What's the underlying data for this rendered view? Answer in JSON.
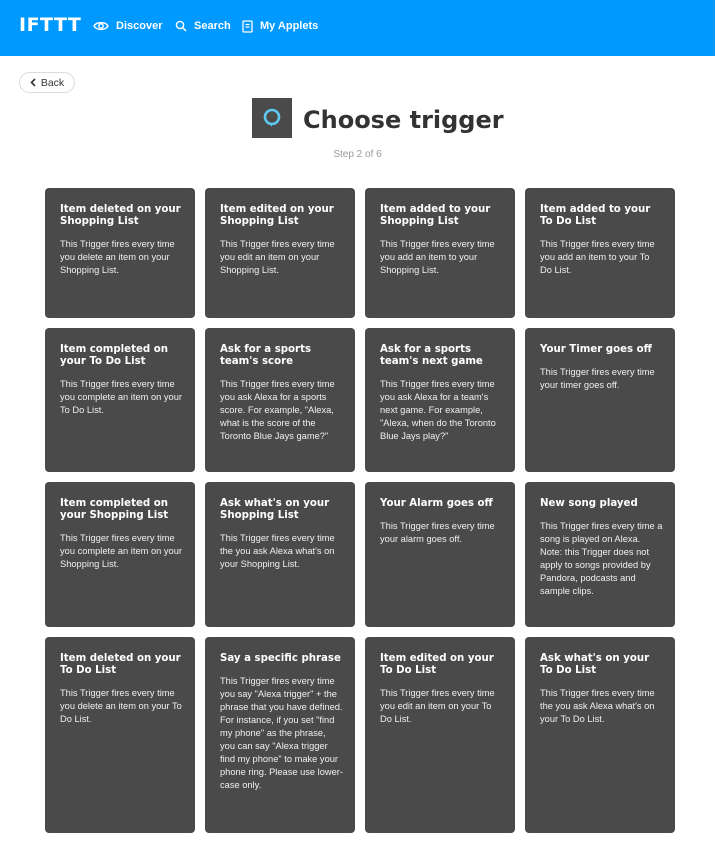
{
  "header": {
    "logo": "IFTTT",
    "nav": [
      {
        "label": "Discover",
        "icon": "eye-icon"
      },
      {
        "label": "Search",
        "icon": "search-icon"
      },
      {
        "label": "My Applets",
        "icon": "applets-icon"
      }
    ]
  },
  "back_label": "Back",
  "page": {
    "title": "Choose trigger",
    "step": "Step 2 of 6",
    "service_icon": "alexa-icon"
  },
  "colors": {
    "header_bg": "#0099ff",
    "card_bg": "#4a4a4a",
    "title_text": "#333333"
  },
  "triggers": [
    {
      "title": "Item deleted on your Shopping List",
      "desc": "This Trigger fires every time you delete an item on your Shopping List."
    },
    {
      "title": "Item edited on your Shopping List",
      "desc": "This Trigger fires every time you edit an item on your Shopping List."
    },
    {
      "title": "Item added to your Shopping List",
      "desc": "This Trigger fires every time you add an item to your Shopping List."
    },
    {
      "title": "Item added to your To Do List",
      "desc": "This Trigger fires every time you add an item to your To Do List."
    },
    {
      "title": "Item completed on your To Do List",
      "desc": "This Trigger fires every time you complete an item on your To Do List."
    },
    {
      "title": "Ask for a sports team's score",
      "desc": "This Trigger fires every time you ask Alexa for a sports score. For example, \"Alexa, what is the score of the Toronto Blue Jays game?\""
    },
    {
      "title": "Ask for a sports team's next game",
      "desc": "This Trigger fires every time you ask Alexa for a team's next game. For example, \"Alexa, when do the Toronto Blue Jays play?\""
    },
    {
      "title": "Your Timer goes off",
      "desc": "This Trigger fires every time your timer goes off."
    },
    {
      "title": "Item completed on your Shopping List",
      "desc": "This Trigger fires every time you complete an item on your Shopping List."
    },
    {
      "title": "Ask what's on your Shopping List",
      "desc": "This Trigger fires every time the you ask Alexa what's on your Shopping List."
    },
    {
      "title": "Your Alarm goes off",
      "desc": "This Trigger fires every time your alarm goes off."
    },
    {
      "title": "New song played",
      "desc": "This Trigger fires every time a song is played on Alexa. Note: this Trigger does not apply to songs provided by Pandora, podcasts and sample clips."
    },
    {
      "title": "Item deleted on your To Do List",
      "desc": "This Trigger fires every time you delete an item on your To Do List."
    },
    {
      "title": "Say a specific phrase",
      "desc": "This Trigger fires every time you say \"Alexa trigger\" + the phrase that you have defined. For instance, if you set \"find my phone\" as the phrase, you can say \"Alexa trigger find my phone\" to make your phone ring. Please use lower-case only."
    },
    {
      "title": "Item edited on your To Do List",
      "desc": "This Trigger fires every time you edit an item on your To Do List."
    },
    {
      "title": "Ask what's on your To Do List",
      "desc": "This Trigger fires every time the you ask Alexa what's on your To Do List."
    }
  ]
}
